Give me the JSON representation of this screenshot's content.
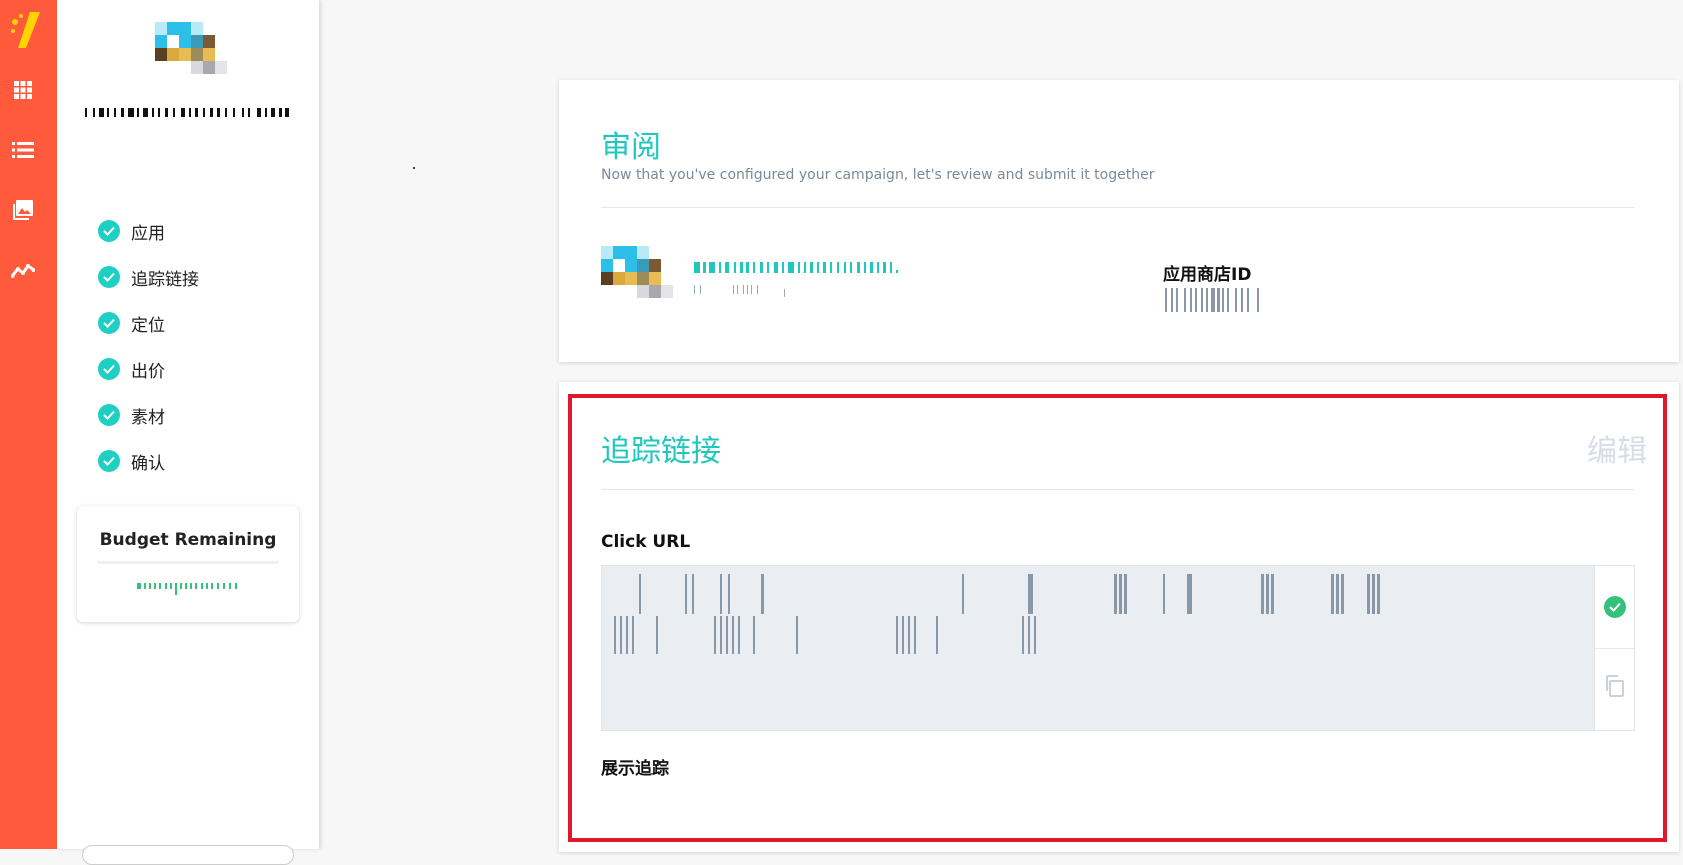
{
  "rail": {
    "brand_color": "#ff5a3c",
    "icons": [
      "logo-icon",
      "grid-icon",
      "list-icon",
      "image-icon",
      "analytics-icon"
    ]
  },
  "sidebar": {
    "steps": [
      {
        "label": "应用",
        "status": "done"
      },
      {
        "label": "追踪链接",
        "status": "done"
      },
      {
        "label": "定位",
        "status": "done"
      },
      {
        "label": "出价",
        "status": "done"
      },
      {
        "label": "素材",
        "status": "done"
      },
      {
        "label": "确认",
        "status": "done"
      }
    ],
    "budget": {
      "title": "Budget Remaining"
    }
  },
  "review": {
    "title": "审阅",
    "subtitle": "Now that you've configured your campaign, let's review and submit it together",
    "store_id_label": "应用商店ID"
  },
  "tracking": {
    "title": "追踪链接",
    "edit_label": "编辑",
    "click_url_label": "Click URL",
    "impression_label": "展示追踪"
  },
  "colors": {
    "accent": "#1fc7bd",
    "check": "#1fcfc3",
    "valid": "#35c07b",
    "highlight": "#e0192a"
  }
}
